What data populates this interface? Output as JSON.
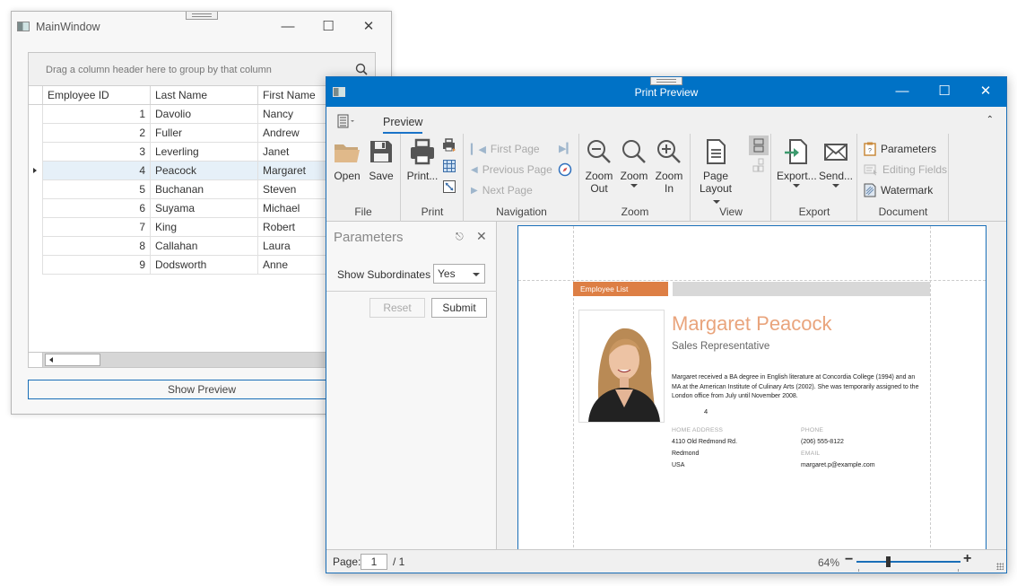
{
  "main_window": {
    "title": "MainWindow",
    "group_panel_text": "Drag a column header here to group by that column",
    "columns": [
      "Employee ID",
      "Last Name",
      "First Name"
    ],
    "rows": [
      {
        "id": "1",
        "last": "Davolio",
        "first": "Nancy"
      },
      {
        "id": "2",
        "last": "Fuller",
        "first": "Andrew"
      },
      {
        "id": "3",
        "last": "Leverling",
        "first": "Janet"
      },
      {
        "id": "4",
        "last": "Peacock",
        "first": "Margaret"
      },
      {
        "id": "5",
        "last": "Buchanan",
        "first": "Steven"
      },
      {
        "id": "6",
        "last": "Suyama",
        "first": "Michael"
      },
      {
        "id": "7",
        "last": "King",
        "first": "Robert"
      },
      {
        "id": "8",
        "last": "Callahan",
        "first": "Laura"
      },
      {
        "id": "9",
        "last": "Dodsworth",
        "first": "Anne"
      }
    ],
    "selected_row_index": 3,
    "show_preview_label": "Show Preview"
  },
  "preview_window": {
    "title": "Print Preview",
    "accent_color": "#0072c6",
    "tabs": [
      "Preview"
    ],
    "ribbon": {
      "file": {
        "label": "File",
        "open": "Open",
        "save": "Save"
      },
      "print": {
        "label": "Print",
        "print": "Print..."
      },
      "navigation": {
        "label": "Navigation",
        "first": "First Page",
        "previous": "Previous Page",
        "next": "Next Page"
      },
      "zoom": {
        "label": "Zoom",
        "zoom_out": "Zoom Out",
        "zoom": "Zoom",
        "zoom_in": "Zoom In"
      },
      "view": {
        "label": "View",
        "page_layout": "Page Layout"
      },
      "export": {
        "label": "Export",
        "export": "Export...",
        "send": "Send..."
      },
      "document": {
        "label": "Document",
        "parameters": "Parameters",
        "editing_fields": "Editing Fields",
        "watermark": "Watermark"
      }
    },
    "parameters_panel": {
      "title": "Parameters",
      "show_subordinates_label": "Show Subordinates",
      "show_subordinates_value": "Yes",
      "reset": "Reset",
      "submit": "Submit"
    },
    "report": {
      "header": "Employee List",
      "header_color": "#dd7f45",
      "name": "Margaret Peacock",
      "job_title": "Sales Representative",
      "bio": "Margaret received a BA degree in English literature at Concordia College (1994) and an MA at the American Institute of Culinary Arts (2002). She was temporarily assigned to the London office from July until November 2008.",
      "employee_id": "4",
      "home_address_label": "HOME ADDRESS",
      "address_lines": [
        "4110 Old Redmond Rd.",
        "Redmond",
        "USA"
      ],
      "phone_label": "PHONE",
      "phone": "(206) 555-8122",
      "email_label": "EMAIL",
      "email": "margaret.p@example.com"
    },
    "status": {
      "page_label": "Page:",
      "page_value": "1",
      "page_total": "/ 1",
      "zoom_percent": "64%",
      "zoom_slider_fraction": 0.3
    }
  }
}
